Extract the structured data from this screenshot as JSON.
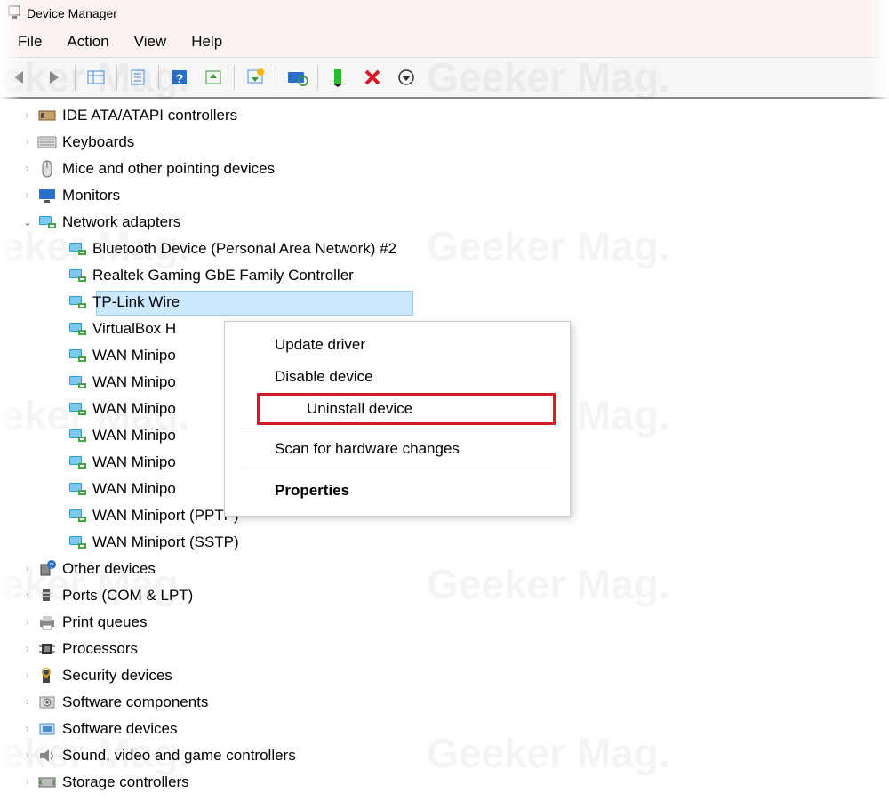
{
  "window": {
    "title": "Device Manager"
  },
  "menubar": {
    "items": [
      "File",
      "Action",
      "View",
      "Help"
    ]
  },
  "toolbar": {
    "icons": [
      "back-arrow-icon",
      "forward-arrow-icon",
      "|",
      "show-hidden-icon",
      "properties-icon",
      "|",
      "help-icon",
      "update-driver-icon",
      "|",
      "uninstall-icon",
      "|",
      "scan-hardware-icon",
      "|",
      "add-legacy-icon",
      "remove-device-icon",
      "circle-down-icon"
    ]
  },
  "tree": {
    "categories": [
      {
        "label": "IDE ATA/ATAPI controllers",
        "icon": "ide-controller-icon",
        "expanded": false
      },
      {
        "label": "Keyboards",
        "icon": "keyboard-icon",
        "expanded": false
      },
      {
        "label": "Mice and other pointing devices",
        "icon": "mouse-icon",
        "expanded": false
      },
      {
        "label": "Monitors",
        "icon": "monitor-icon",
        "expanded": false
      },
      {
        "label": "Network adapters",
        "icon": "network-adapter-icon",
        "expanded": true,
        "children": [
          {
            "label": "Bluetooth Device (Personal Area Network) #2",
            "icon": "network-adapter-icon"
          },
          {
            "label": "Realtek Gaming GbE Family Controller",
            "icon": "network-adapter-icon"
          },
          {
            "label": "TP-Link Wire",
            "icon": "network-adapter-icon",
            "selected": true
          },
          {
            "label": "VirtualBox H",
            "icon": "network-adapter-icon"
          },
          {
            "label": "WAN Minipo",
            "icon": "network-adapter-icon"
          },
          {
            "label": "WAN Minipo",
            "icon": "network-adapter-icon"
          },
          {
            "label": "WAN Minipo",
            "icon": "network-adapter-icon"
          },
          {
            "label": "WAN Minipo",
            "icon": "network-adapter-icon"
          },
          {
            "label": "WAN Minipo",
            "icon": "network-adapter-icon"
          },
          {
            "label": "WAN Minipo",
            "icon": "network-adapter-icon"
          },
          {
            "label": "WAN Miniport (PPTP)",
            "icon": "network-adapter-icon"
          },
          {
            "label": "WAN Miniport (SSTP)",
            "icon": "network-adapter-icon"
          }
        ]
      },
      {
        "label": "Other devices",
        "icon": "other-devices-icon",
        "expanded": false
      },
      {
        "label": "Ports (COM & LPT)",
        "icon": "ports-icon",
        "expanded": false
      },
      {
        "label": "Print queues",
        "icon": "printer-icon",
        "expanded": false
      },
      {
        "label": "Processors",
        "icon": "processor-icon",
        "expanded": false
      },
      {
        "label": "Security devices",
        "icon": "security-device-icon",
        "expanded": false
      },
      {
        "label": "Software components",
        "icon": "software-component-icon",
        "expanded": false
      },
      {
        "label": "Software devices",
        "icon": "software-device-icon",
        "expanded": false
      },
      {
        "label": "Sound, video and game controllers",
        "icon": "audio-icon",
        "expanded": false
      },
      {
        "label": "Storage controllers",
        "icon": "storage-controller-icon",
        "expanded": false
      }
    ]
  },
  "context_menu": {
    "items": [
      {
        "label": "Update driver"
      },
      {
        "label": "Disable device"
      },
      {
        "label": "Uninstall device",
        "highlighted": true
      },
      {
        "separator": true
      },
      {
        "label": "Scan for hardware changes"
      },
      {
        "separator": true
      },
      {
        "label": "Properties",
        "bold": true
      }
    ]
  },
  "watermark": "Geeker Mag."
}
